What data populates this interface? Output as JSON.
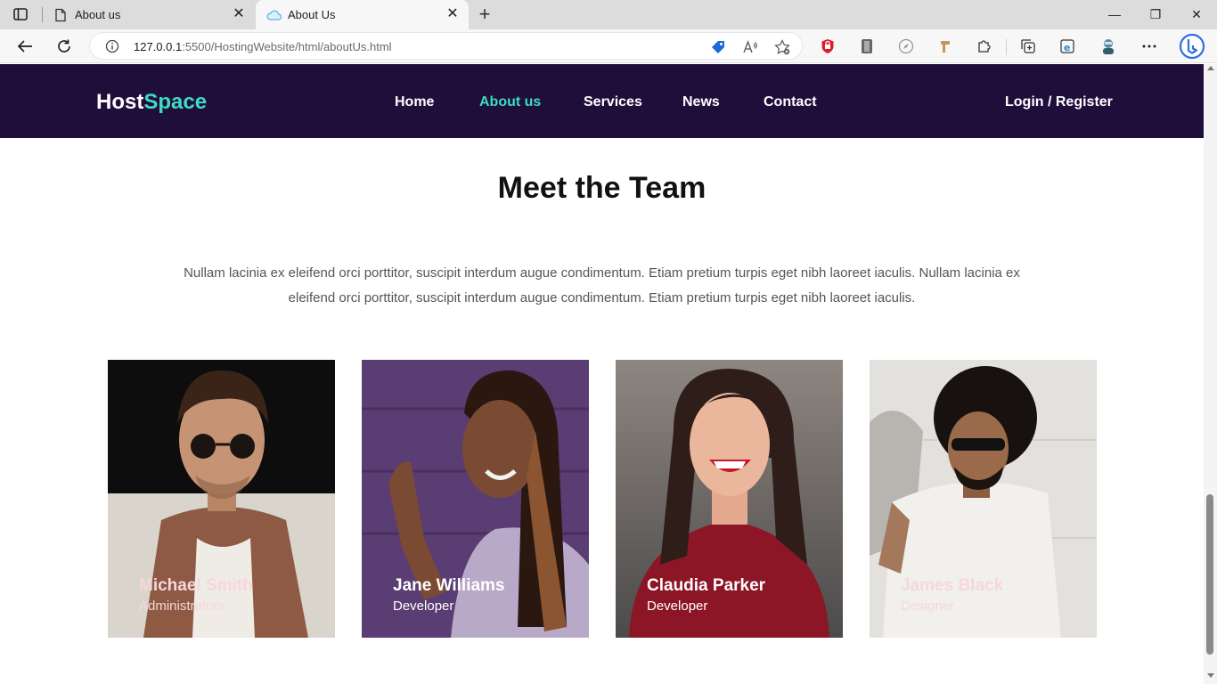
{
  "browser": {
    "tabs": [
      {
        "title": "About us",
        "active": false,
        "icon": "page-icon"
      },
      {
        "title": "About Us",
        "active": true,
        "icon": "cloud-icon"
      }
    ],
    "address": {
      "host": "127.0.0.1",
      "path": ":5500/HostingWebsite/html/aboutUs.html"
    }
  },
  "site": {
    "logo_main": "Host",
    "logo_accent": "Space",
    "nav": [
      "Home",
      "About us",
      "Services",
      "News",
      "Contact"
    ],
    "active_nav": "About us",
    "login": "Login / Register"
  },
  "team": {
    "title": "Meet the Team",
    "description": "Nullam lacinia ex eleifend orci porttitor, suscipit interdum augue condimentum. Etiam pretium turpis eget nibh laoreet iaculis. Nullam lacinia ex eleifend orci porttitor, suscipit interdum augue condimentum. Etiam pretium turpis eget nibh laoreet iaculis.",
    "members": [
      {
        "name": "Michael Smith",
        "role": "Administrators"
      },
      {
        "name": "Jane Williams",
        "role": "Developer"
      },
      {
        "name": "Claudia Parker",
        "role": "Developer"
      },
      {
        "name": "James Black",
        "role": "Designer"
      }
    ]
  },
  "colors": {
    "header_bg": "#1f0e3a",
    "accent": "#3ddbc0"
  }
}
